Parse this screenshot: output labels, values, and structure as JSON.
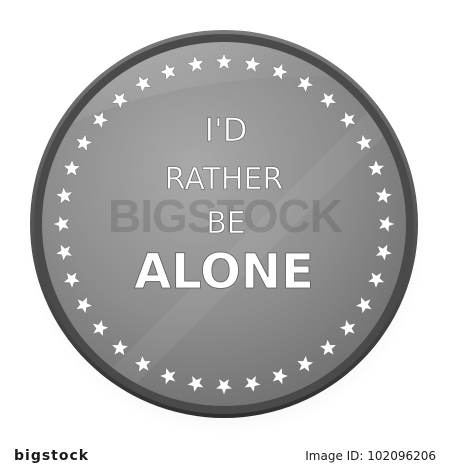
{
  "button": {
    "line1": "I'D",
    "line2": "RATHER",
    "line3": "BE",
    "line4": "ALONE"
  },
  "watermark": {
    "text": "BIGSTOCK"
  },
  "footer": {
    "logo": "bigstock",
    "image_id": "Image ID: 102096206"
  },
  "colors": {
    "button_face": "#8c8c8c",
    "button_rim": "#555555",
    "stars": "#ffffff",
    "text": "#ffffff",
    "background": "#ffffff"
  },
  "star_count": 36
}
